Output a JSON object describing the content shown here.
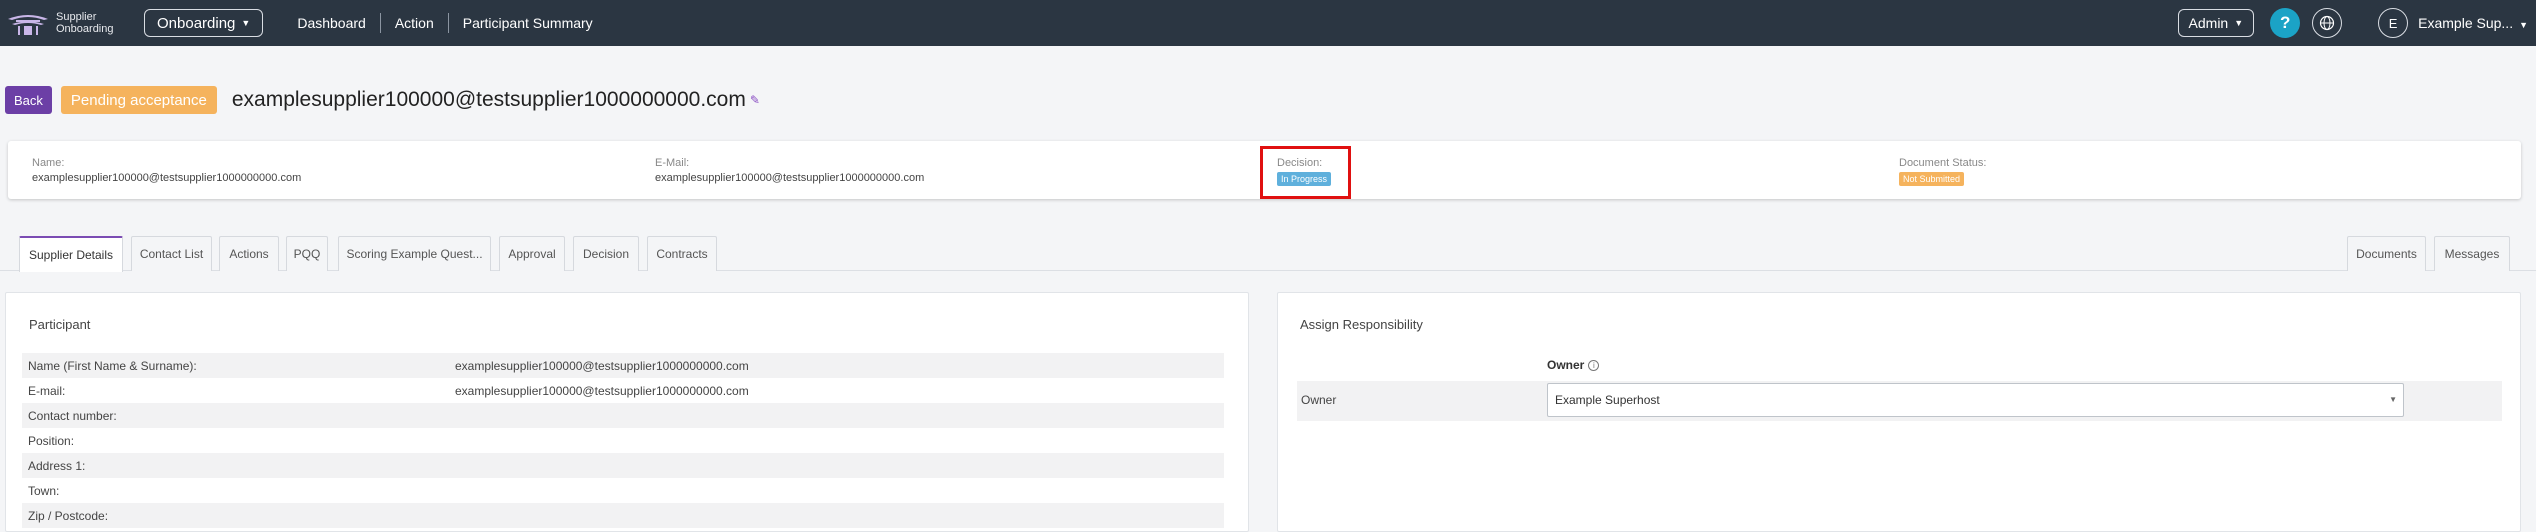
{
  "app": {
    "logo_line1": "Supplier",
    "logo_line2": "Onboarding",
    "module_dropdown": "Onboarding",
    "nav_links": [
      "Dashboard",
      "Action",
      "Participant Summary"
    ],
    "admin_label": "Admin",
    "help_label": "?",
    "user_initial": "E",
    "user_name": "Example Sup..."
  },
  "header": {
    "back_label": "Back",
    "status": "Pending acceptance",
    "title": "examplesupplier100000@testsupplier1000000000.com"
  },
  "summary": {
    "name_label": "Name:",
    "name_value": "examplesupplier100000@testsupplier1000000000.com",
    "email_label": "E-Mail:",
    "email_value": "examplesupplier100000@testsupplier1000000000.com",
    "decision_label": "Decision:",
    "decision_value": "In Progress",
    "document_label": "Document Status:",
    "document_value": "Not Submitted"
  },
  "tabs": {
    "left": [
      "Supplier Details",
      "Contact List",
      "Actions",
      "PQQ",
      "Scoring Example Quest...",
      "Approval",
      "Decision",
      "Contracts"
    ],
    "right": [
      "Documents",
      "Messages"
    ],
    "active": "Supplier Details"
  },
  "participant": {
    "title": "Participant",
    "rows": [
      {
        "label": "Name (First Name & Surname):",
        "value": "examplesupplier100000@testsupplier1000000000.com"
      },
      {
        "label": "E-mail:",
        "value": "examplesupplier100000@testsupplier1000000000.com"
      },
      {
        "label": "Contact number:",
        "value": ""
      },
      {
        "label": "Position:",
        "value": ""
      },
      {
        "label": "Address 1:",
        "value": ""
      },
      {
        "label": "Town:",
        "value": ""
      },
      {
        "label": "Zip / Postcode:",
        "value": ""
      }
    ]
  },
  "responsibility": {
    "title": "Assign Responsibility",
    "column_header": "Owner",
    "row_label": "Owner",
    "selected_owner": "Example Superhost"
  },
  "colors": {
    "nav_bg": "#2b3642",
    "accent_purple": "#6c3fa6",
    "pending_orange": "#f5b35d",
    "in_progress_blue": "#5fb0dc",
    "help_teal": "#1ba3c6",
    "highlight_red": "#e01010"
  }
}
